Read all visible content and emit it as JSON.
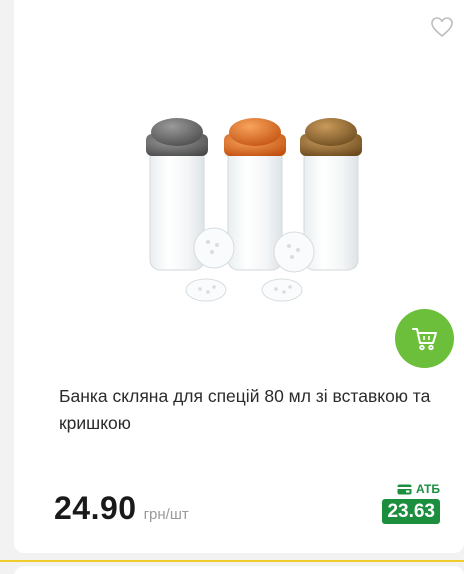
{
  "product": {
    "title": "Банка скляна для спецій 80 мл зі вставкою та кришкою",
    "price": "24.90",
    "unit": "грн/шт",
    "promo_label": "АТБ",
    "promo_price": "23.63",
    "image_alt": "Glass spice jars with grey, orange and gold caps",
    "icons": {
      "favorite": "heart-outline-icon",
      "cart": "cart-icon",
      "promo": "wallet-card-icon"
    }
  },
  "colors": {
    "accent_green": "#6cbf3a",
    "promo_green": "#1c8f3f",
    "divider_yellow": "#f2cc2c"
  }
}
